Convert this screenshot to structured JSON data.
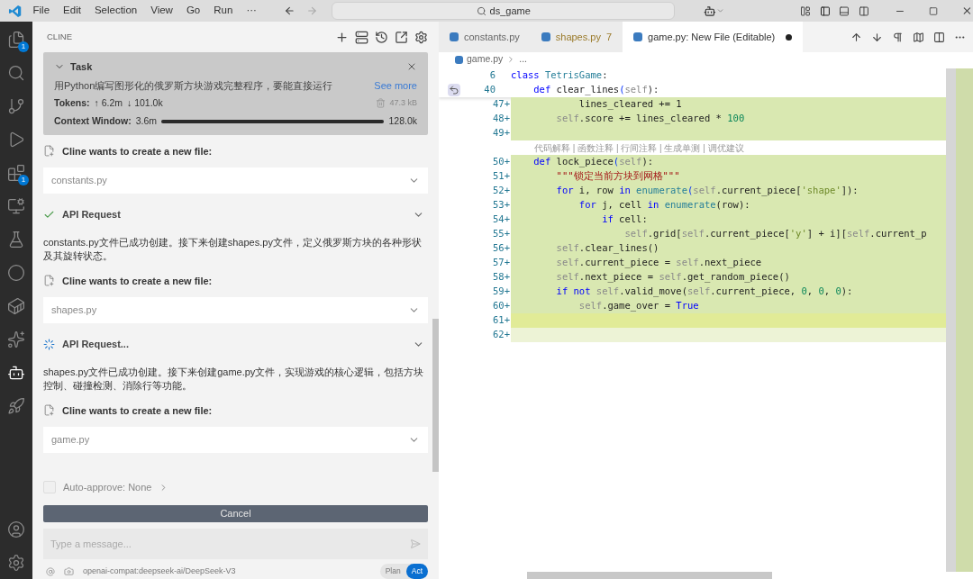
{
  "title_bar": {
    "menu": [
      "File",
      "Edit",
      "Selection",
      "View",
      "Go",
      "Run",
      "···"
    ],
    "search": "ds_game"
  },
  "activity_bar": {
    "items": [
      {
        "badge": "1",
        "selected": false
      },
      {
        "selected": false
      },
      {
        "selected": false
      },
      {
        "selected": false
      },
      {
        "badge": "1",
        "selected": false
      },
      {
        "selected": false
      },
      {
        "selected": false
      },
      {
        "selected": false
      },
      {
        "selected": false
      },
      {
        "selected": false
      },
      {
        "selected": true
      },
      {
        "selected": false
      }
    ]
  },
  "cline": {
    "title": "CLINE",
    "task": {
      "label": "Task",
      "text": "用Python编写图形化的俄罗斯方块游戏完整程序，要能直接运行",
      "see_more": "See more",
      "tokens_label": "Tokens:",
      "tokens_up": "↑ 6.2m",
      "tokens_down": "↓ 101.0k",
      "size": "47.3 kB",
      "context_label": "Context Window:",
      "context_used": "3.6m",
      "context_bar": {
        "level": 1
      },
      "context_max": "128.0k"
    },
    "messages": [
      {
        "kind": "file",
        "title": "Cline wants to create a new file:",
        "file": "constants.py"
      },
      {
        "kind": "api",
        "title": "API Request",
        "done": true
      },
      {
        "kind": "text",
        "text": "constants.py文件已成功创建。接下来创建shapes.py文件，定义俄罗斯方块的各种形状及其旋转状态。"
      },
      {
        "kind": "file",
        "title": "Cline wants to create a new file:",
        "file": "shapes.py"
      },
      {
        "kind": "api",
        "title": "API Request...",
        "done": false
      },
      {
        "kind": "text",
        "text": "shapes.py文件已成功创建。接下来创建game.py文件，实现游戏的核心逻辑，包括方块控制、碰撞检测、消除行等功能。"
      },
      {
        "kind": "file",
        "title": "Cline wants to create a new file:",
        "file": "game.py"
      }
    ],
    "auto_approve": {
      "label": "Auto-approve: None",
      "checked": false
    },
    "cancel": "Cancel",
    "input_placeholder": "Type a message...",
    "model": "openai-compat:deepseek-ai/DeepSeek-V3",
    "modes": [
      {
        "label": "Plan",
        "selected": false
      },
      {
        "label": "Act",
        "selected": true
      }
    ]
  },
  "editor": {
    "tabs": [
      {
        "label": "constants.py",
        "selected": false
      },
      {
        "label": "shapes.py",
        "problems": "7",
        "selected": false
      },
      {
        "label": "game.py: New File (Editable)",
        "dirty": true,
        "selected": true
      }
    ],
    "breadcrumb": [
      "game.py",
      "..."
    ],
    "sticky": [
      {
        "n": "6",
        "tokens": [
          {
            "text": "class ",
            "kind": "kw"
          },
          {
            "text": "TetrisGame",
            "kind": "cls"
          },
          {
            "text": ":",
            "kind": "p"
          }
        ]
      },
      {
        "n": "40",
        "tokens": [
          {
            "text": "    def ",
            "kind": "kw"
          },
          {
            "text": "clear_lines",
            "kind": "fn"
          },
          {
            "text": "(",
            "kind": "br"
          },
          {
            "text": "self",
            "kind": "self"
          },
          {
            "text": "):",
            "kind": "p"
          }
        ]
      }
    ],
    "lines": [
      {
        "n": "47+",
        "kind": "added",
        "tokens": [
          {
            "text": "            lines_cleared += 1",
            "kind": "p"
          }
        ]
      },
      {
        "n": "48+",
        "kind": "added",
        "tokens": [
          {
            "text": "        self",
            "kind": "self"
          },
          {
            "text": ".score += lines_cleared * ",
            "kind": "p"
          },
          {
            "text": "100",
            "kind": "num"
          }
        ]
      },
      {
        "n": "49+",
        "kind": "added",
        "codelens": "代码解释 | 函数注释 | 行间注释 | 生成单测 | 调优建议"
      },
      {
        "n": "50+",
        "kind": "added",
        "tokens": [
          {
            "text": "    def ",
            "kind": "kw"
          },
          {
            "text": "lock_piece",
            "kind": "fn"
          },
          {
            "text": "(",
            "kind": "br"
          },
          {
            "text": "self",
            "kind": "self"
          },
          {
            "text": "):",
            "kind": "p"
          }
        ]
      },
      {
        "n": "51+",
        "kind": "added",
        "tokens": [
          {
            "text": "        \"\"\"锁定当前方块到网格\"\"\"",
            "kind": "str"
          }
        ]
      },
      {
        "n": "52+",
        "kind": "added",
        "tokens": [
          {
            "text": "        for ",
            "kind": "kw"
          },
          {
            "text": "i, row ",
            "kind": "p"
          },
          {
            "text": "in ",
            "kind": "kw"
          },
          {
            "text": "enumerate",
            "kind": "bi"
          },
          {
            "text": "(",
            "kind": "br"
          },
          {
            "text": "self",
            "kind": "self"
          },
          {
            "text": ".current_piece[",
            "kind": "p"
          },
          {
            "text": "'shape'",
            "kind": "s2"
          },
          {
            "text": "]):",
            "kind": "p"
          }
        ]
      },
      {
        "n": "53+",
        "kind": "added",
        "tokens": [
          {
            "text": "            for ",
            "kind": "kw"
          },
          {
            "text": "j, cell ",
            "kind": "p"
          },
          {
            "text": "in ",
            "kind": "kw"
          },
          {
            "text": "enumerate",
            "kind": "bi"
          },
          {
            "text": "(row):",
            "kind": "p"
          }
        ]
      },
      {
        "n": "54+",
        "kind": "added",
        "tokens": [
          {
            "text": "                if ",
            "kind": "kw"
          },
          {
            "text": "cell:",
            "kind": "p"
          }
        ]
      },
      {
        "n": "55+",
        "kind": "added",
        "tokens": [
          {
            "text": "                    self",
            "kind": "self"
          },
          {
            "text": ".grid[",
            "kind": "p"
          },
          {
            "text": "self",
            "kind": "self"
          },
          {
            "text": ".current_piece[",
            "kind": "p"
          },
          {
            "text": "'y'",
            "kind": "s2"
          },
          {
            "text": "] + i][",
            "kind": "p"
          },
          {
            "text": "self",
            "kind": "self"
          },
          {
            "text": ".current_p",
            "kind": "p"
          }
        ]
      },
      {
        "n": "56+",
        "kind": "added",
        "tokens": [
          {
            "text": "        self",
            "kind": "self"
          },
          {
            "text": ".clear_lines()",
            "kind": "p"
          }
        ]
      },
      {
        "n": "57+",
        "kind": "added",
        "tokens": [
          {
            "text": "        self",
            "kind": "self"
          },
          {
            "text": ".current_piece = ",
            "kind": "p"
          },
          {
            "text": "self",
            "kind": "self"
          },
          {
            "text": ".next_piece",
            "kind": "p"
          }
        ]
      },
      {
        "n": "58+",
        "kind": "added",
        "tokens": [
          {
            "text": "        self",
            "kind": "self"
          },
          {
            "text": ".next_piece = ",
            "kind": "p"
          },
          {
            "text": "self",
            "kind": "self"
          },
          {
            "text": ".get_random_piece()",
            "kind": "p"
          }
        ]
      },
      {
        "n": "59+",
        "kind": "added",
        "tokens": [
          {
            "text": "        if not ",
            "kind": "kw"
          },
          {
            "text": "self",
            "kind": "self"
          },
          {
            "text": ".valid_move(",
            "kind": "p"
          },
          {
            "text": "self",
            "kind": "self"
          },
          {
            "text": ".current_piece, ",
            "kind": "p"
          },
          {
            "text": "0",
            "kind": "num"
          },
          {
            "text": ", ",
            "kind": "p"
          },
          {
            "text": "0",
            "kind": "num"
          },
          {
            "text": ", ",
            "kind": "p"
          },
          {
            "text": "0",
            "kind": "num"
          },
          {
            "text": "):",
            "kind": "p"
          }
        ]
      },
      {
        "n": "60+",
        "kind": "added",
        "tokens": [
          {
            "text": "            self",
            "kind": "self"
          },
          {
            "text": ".game_over = ",
            "kind": "p"
          },
          {
            "text": "True",
            "kind": "kw"
          }
        ]
      },
      {
        "n": "61+",
        "kind": "current"
      },
      {
        "n": "62+",
        "kind": "pending"
      }
    ]
  }
}
